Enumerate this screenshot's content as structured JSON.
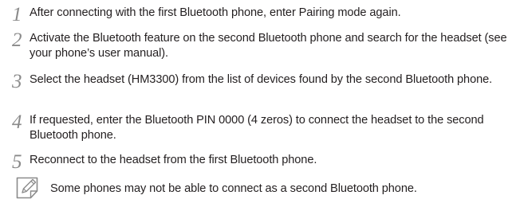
{
  "steps": [
    {
      "number": "1",
      "text": "After connecting with the first Bluetooth phone, enter Pairing mode again."
    },
    {
      "number": "2",
      "text": "Activate the Bluetooth feature on the second Bluetooth phone and search for the headset (see your phone’s user manual)."
    },
    {
      "number": "3",
      "text": "Select the headset (HM3300) from the list of devices found by the second Bluetooth phone."
    },
    {
      "number": "4",
      "text": "If requested, enter the Bluetooth PIN 0000 (4 zeros) to connect the headset to the second Bluetooth phone."
    },
    {
      "number": "5",
      "text": "Reconnect to the headset from the first Bluetooth phone."
    }
  ],
  "note": {
    "icon": "note-icon",
    "text": "Some phones may not be able to connect as a second Bluetooth phone."
  }
}
